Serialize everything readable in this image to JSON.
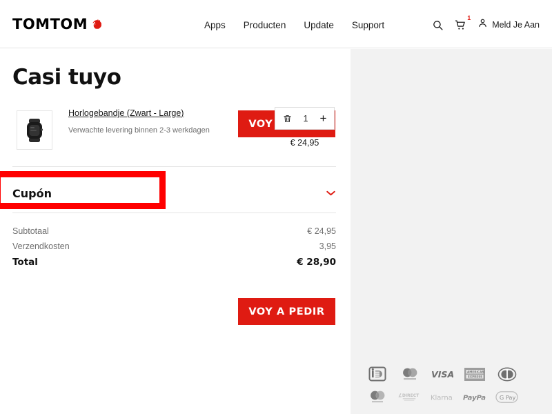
{
  "header": {
    "logo_text": "TOMTOM",
    "logo_icon": "tomtom-hand-icon",
    "nav": [
      {
        "label": "Apps"
      },
      {
        "label": "Producten"
      },
      {
        "label": "Update"
      },
      {
        "label": "Support"
      }
    ],
    "search_icon": "search-icon",
    "cart_icon": "cart-icon",
    "cart_count": "1",
    "account_icon": "person-icon",
    "account_label": "Meld Je Aan"
  },
  "cart": {
    "title": "Casi tuyo",
    "checkout_button_top": "VOY A PEDIR",
    "checkout_button_bottom": "VOY A PEDIR",
    "item": {
      "image_alt": "watch-strap-thumbnail",
      "name": "Horlogebandje (Zwart - Large)",
      "delivery": "Verwachte levering binnen 2-3 werkdagen",
      "remove_icon": "trash-icon",
      "quantity": "1",
      "increase_label": "+",
      "price": "€ 24,95"
    },
    "coupon": {
      "label": "Cupón",
      "chevron_icon": "chevron-down-icon"
    },
    "totals": [
      {
        "label": "Subtotaal",
        "value": "€ 24,95",
        "emphasis": false
      },
      {
        "label": "Verzendkosten",
        "value": "3,95",
        "emphasis": false
      },
      {
        "label": "Total",
        "value": "€ 28,90",
        "emphasis": true
      }
    ]
  },
  "payments": {
    "row1": [
      {
        "name": "ideal-icon",
        "label": "iDEAL"
      },
      {
        "name": "mastercard-icon",
        "label": "Mastercard"
      },
      {
        "name": "visa-icon",
        "label": "VISA"
      },
      {
        "name": "amex-icon",
        "label": "American Express"
      },
      {
        "name": "diners-club-icon",
        "label": "Diners Club"
      }
    ],
    "row2": [
      {
        "name": "maestro-icon",
        "label": "Maestro"
      },
      {
        "name": "sofort-direct-icon",
        "label": "DIRECT"
      },
      {
        "name": "klarna-icon",
        "label": "Klarna."
      },
      {
        "name": "paypal-icon",
        "label": "PayPal"
      },
      {
        "name": "google-pay-icon",
        "label": "G Pay"
      }
    ]
  },
  "annotation": {
    "name": "coupon-highlight-box",
    "color": "#ff0000"
  },
  "colors": {
    "brand_red": "#df1b12",
    "annotation_red": "#ff0000",
    "panel_gray": "#f2f2f2",
    "text_dark": "#1c1c1c",
    "text_muted": "#6e6e6e"
  }
}
